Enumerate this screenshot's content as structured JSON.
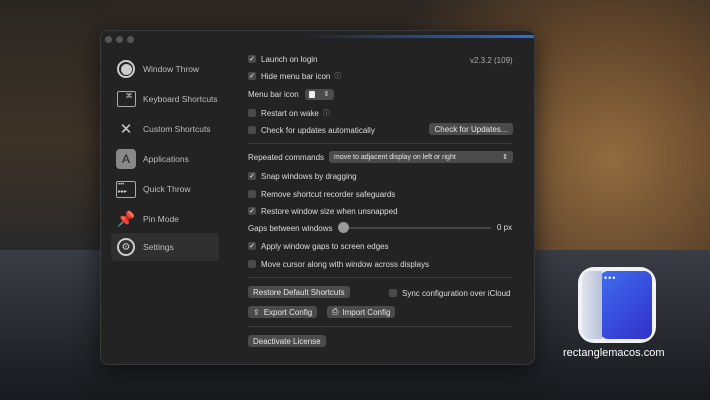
{
  "sidebar": {
    "items": [
      {
        "label": "Window Throw",
        "icon": "window-throw-icon"
      },
      {
        "label": "Keyboard Shortcuts",
        "icon": "keyboard-command-icon"
      },
      {
        "label": "Custom Shortcuts",
        "icon": "tools-icon"
      },
      {
        "label": "Applications",
        "icon": "app-store-icon"
      },
      {
        "label": "Quick Throw",
        "icon": "quick-throw-icon"
      },
      {
        "label": "Pin Mode",
        "icon": "pin-icon"
      },
      {
        "label": "Settings",
        "icon": "gear-icon",
        "selected": true
      }
    ]
  },
  "settings": {
    "version": "v2.3.2 (109)",
    "launch_on_login": {
      "label": "Launch on login",
      "checked": true
    },
    "hide_menu_bar_icon": {
      "label": "Hide menu bar icon",
      "checked": true
    },
    "menu_bar_icon_label": "Menu bar icon",
    "restart_on_wake": {
      "label": "Restart on wake",
      "checked": false
    },
    "check_updates": {
      "label": "Check for updates automatically",
      "checked": false
    },
    "check_updates_button": "Check for Updates...",
    "repeated_commands_label": "Repeated commands",
    "repeated_commands_value": "move to adjacent display on left or right",
    "snap_windows": {
      "label": "Snap windows by dragging",
      "checked": true
    },
    "remove_safeguards": {
      "label": "Remove shortcut recorder safeguards",
      "checked": false
    },
    "restore_size": {
      "label": "Restore window size when unsnapped",
      "checked": true
    },
    "gaps_label": "Gaps between windows",
    "gaps_value": "0 px",
    "gaps_slider_value": 0,
    "apply_gaps": {
      "label": "Apply window gaps to screen edges",
      "checked": true
    },
    "move_cursor": {
      "label": "Move cursor along with window across displays",
      "checked": false
    },
    "restore_defaults_button": "Restore Default Shortcuts",
    "sync_icloud": {
      "label": "Sync configuration over iCloud",
      "checked": false
    },
    "export_button": "Export Config",
    "import_button": "Import Config",
    "deactivate_button": "Deactivate License"
  },
  "watermark": {
    "text": "rectanglemacos.com"
  },
  "colors": {
    "accent": "#2b6fd9",
    "window_bg": "#232323"
  }
}
